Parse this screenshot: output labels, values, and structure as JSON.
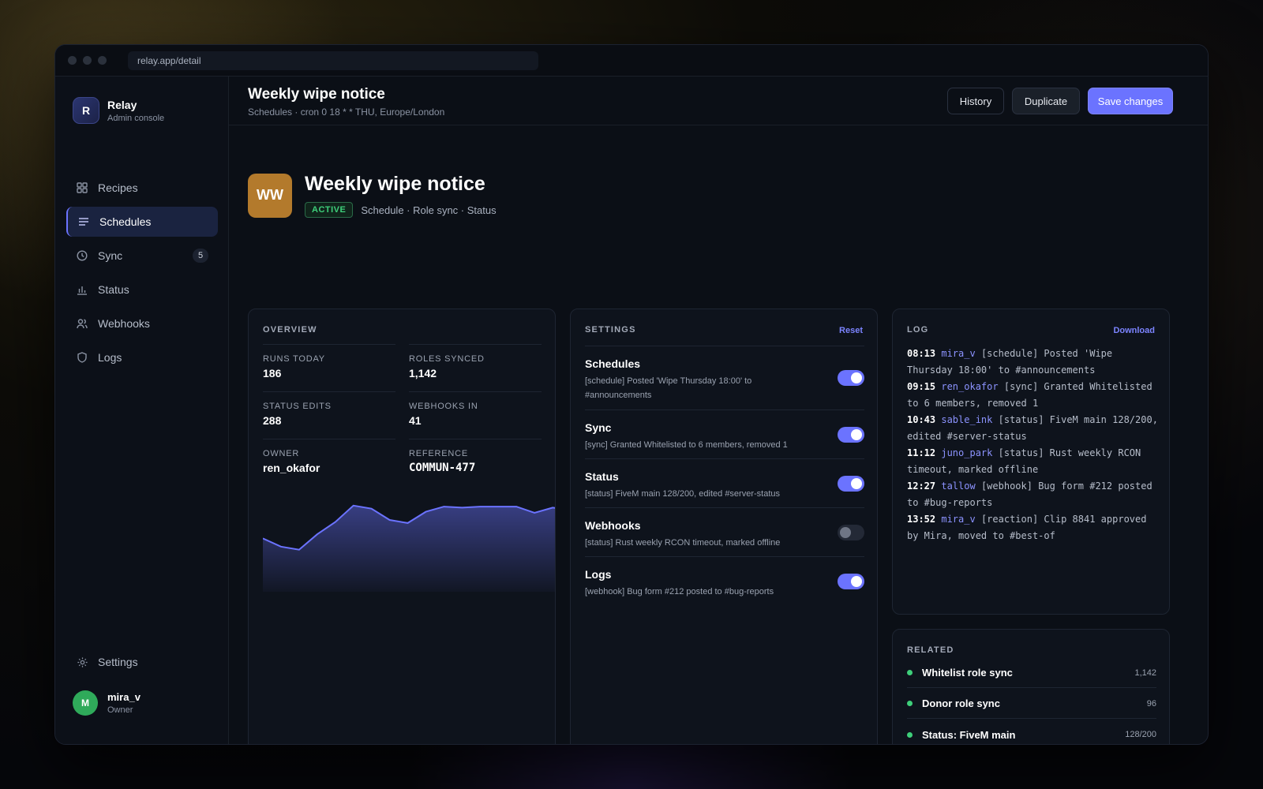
{
  "window": {
    "url": "relay.app/detail"
  },
  "brand": {
    "name": "Relay",
    "subtitle": "Admin console",
    "logo_letter": "R"
  },
  "sidebar": {
    "items": [
      {
        "label": "Recipes",
        "icon": "grid-icon"
      },
      {
        "label": "Schedules",
        "icon": "list-icon",
        "active": true
      },
      {
        "label": "Sync",
        "icon": "clock-icon",
        "badge": "5"
      },
      {
        "label": "Status",
        "icon": "bar-chart-icon"
      },
      {
        "label": "Webhooks",
        "icon": "users-icon"
      },
      {
        "label": "Logs",
        "icon": "shield-icon"
      }
    ],
    "settings_label": "Settings"
  },
  "user": {
    "name": "mira_v",
    "role": "Owner",
    "initial": "M"
  },
  "header": {
    "title": "Weekly wipe notice",
    "subtitle": "Schedules · cron 0 18 * * THU, Europe/London",
    "history_label": "History",
    "duplicate_label": "Duplicate",
    "save_label": "Save changes"
  },
  "hero": {
    "initials": "WW",
    "title": "Weekly wipe notice",
    "status": "ACTIVE",
    "tags": "Schedule · Role sync · Status"
  },
  "overview": {
    "title": "OVERVIEW",
    "stats": [
      {
        "label": "RUNS TODAY",
        "value": "186"
      },
      {
        "label": "ROLES SYNCED",
        "value": "1,142"
      },
      {
        "label": "STATUS EDITS",
        "value": "288"
      },
      {
        "label": "WEBHOOKS IN",
        "value": "41"
      },
      {
        "label": "OWNER",
        "value": "ren_okafor"
      },
      {
        "label": "REFERENCE",
        "value": "COMMUN-477"
      }
    ]
  },
  "chart_data": {
    "type": "area",
    "x": [
      1,
      2,
      3,
      4,
      5,
      6,
      7,
      8,
      9,
      10,
      11,
      12,
      13,
      14,
      15,
      16,
      17,
      18
    ],
    "values": [
      52,
      44,
      41,
      56,
      68,
      84,
      81,
      70,
      67,
      78,
      83,
      82,
      83,
      83,
      83,
      77,
      82,
      80
    ],
    "ylim": [
      0,
      100
    ],
    "color": "#6b73ff",
    "grid": false
  },
  "settings": {
    "title": "SETTINGS",
    "reset_label": "Reset",
    "rows": [
      {
        "name": "Schedules",
        "desc": "[schedule] Posted 'Wipe Thursday 18:00' to #announcements",
        "on": true
      },
      {
        "name": "Sync",
        "desc": "[sync] Granted Whitelisted to 6 members, removed 1",
        "on": true
      },
      {
        "name": "Status",
        "desc": "[status] FiveM main 128/200, edited #server-status",
        "on": true
      },
      {
        "name": "Webhooks",
        "desc": "[status] Rust weekly RCON timeout, marked offline",
        "on": false
      },
      {
        "name": "Logs",
        "desc": "[webhook] Bug form #212 posted to #bug-reports",
        "on": true
      }
    ]
  },
  "log": {
    "title": "LOG",
    "download_label": "Download",
    "entries": [
      {
        "time": "08:13",
        "user": "mira_v",
        "text": "[schedule] Posted 'Wipe Thursday 18:00' to #announcements"
      },
      {
        "time": "09:15",
        "user": "ren_okafor",
        "text": "[sync] Granted Whitelisted to 6 members, removed 1"
      },
      {
        "time": "10:43",
        "user": "sable_ink",
        "text": "[status] FiveM main 128/200, edited #server-status"
      },
      {
        "time": "11:12",
        "user": "juno_park",
        "text": "[status] Rust weekly RCON timeout, marked offline"
      },
      {
        "time": "12:27",
        "user": "tallow",
        "text": "[webhook] Bug form #212 posted to #bug-reports"
      },
      {
        "time": "13:52",
        "user": "mira_v",
        "text": "[reaction] Clip 8841 approved by Mira, moved to #best-of"
      }
    ]
  },
  "related": {
    "title": "RELATED",
    "items": [
      {
        "name": "Whitelist role sync",
        "count": "1,142"
      },
      {
        "name": "Donor role sync",
        "count": "96"
      },
      {
        "name": "Status: FiveM main",
        "count": "128/200"
      }
    ]
  }
}
